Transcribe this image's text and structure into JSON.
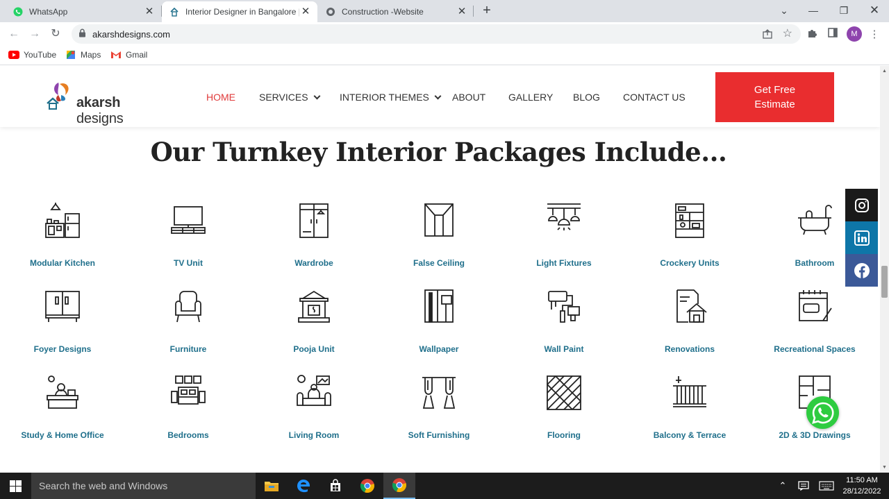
{
  "browser": {
    "tabs": [
      {
        "title": "WhatsApp",
        "icon": "whatsapp-icon",
        "active": false
      },
      {
        "title": "Interior Designer in Bangalore | Best",
        "icon": "akarsh-favicon",
        "active": true
      },
      {
        "title": "Construction -Website",
        "icon": "globe-icon",
        "active": false
      }
    ],
    "url": "akarshdesigns.com",
    "bookmarks": [
      {
        "label": "YouTube",
        "icon": "youtube-icon"
      },
      {
        "label": "Maps",
        "icon": "maps-icon"
      },
      {
        "label": "Gmail",
        "icon": "gmail-icon"
      }
    ],
    "profile_initial": "M"
  },
  "site": {
    "logo": {
      "brand_bold": "akarsh",
      "brand_rest": " designs"
    },
    "nav": [
      {
        "label": "HOME",
        "dropdown": false
      },
      {
        "label": "SERVICES",
        "dropdown": true
      },
      {
        "label": "INTERIOR THEMES",
        "dropdown": true
      },
      {
        "label": "ABOUT",
        "dropdown": false
      },
      {
        "label": "GALLERY",
        "dropdown": false
      },
      {
        "label": "BLOG",
        "dropdown": false
      },
      {
        "label": "CONTACT US",
        "dropdown": false
      }
    ],
    "cta_label": "Get Free Estimate",
    "section_title": "Our Turnkey Interior Packages Include...",
    "packages": [
      {
        "label": "Modular Kitchen",
        "icon": "kitchen-icon"
      },
      {
        "label": "TV Unit",
        "icon": "tv-unit-icon"
      },
      {
        "label": "Wardrobe",
        "icon": "wardrobe-icon"
      },
      {
        "label": "False Ceiling",
        "icon": "false-ceiling-icon"
      },
      {
        "label": "Light Fixtures",
        "icon": "light-fixtures-icon"
      },
      {
        "label": "Crockery Units",
        "icon": "crockery-icon"
      },
      {
        "label": "Bathroom",
        "icon": "bathtub-icon"
      },
      {
        "label": "Foyer Designs",
        "icon": "foyer-icon"
      },
      {
        "label": "Furniture",
        "icon": "armchair-icon"
      },
      {
        "label": "Pooja Unit",
        "icon": "temple-icon"
      },
      {
        "label": "Wallpaper",
        "icon": "wallpaper-icon"
      },
      {
        "label": "Wall Paint",
        "icon": "paint-roller-icon"
      },
      {
        "label": "Renovations",
        "icon": "renovation-icon"
      },
      {
        "label": "Recreational Spaces",
        "icon": "recreation-icon"
      },
      {
        "label": "Study & Home Office",
        "icon": "study-desk-icon"
      },
      {
        "label": "Bedrooms",
        "icon": "bed-icon"
      },
      {
        "label": "Living Room",
        "icon": "sofa-icon"
      },
      {
        "label": "Soft Furnishing",
        "icon": "curtains-icon"
      },
      {
        "label": "Flooring",
        "icon": "flooring-icon"
      },
      {
        "label": "Balcony & Terrace",
        "icon": "balcony-icon"
      },
      {
        "label": "2D & 3D Drawings",
        "icon": "floorplan-icon"
      }
    ],
    "social": [
      {
        "name": "instagram",
        "color": "#1a1a1a"
      },
      {
        "name": "linkedin",
        "color": "#0e76a8"
      },
      {
        "name": "facebook",
        "color": "#3b5998"
      }
    ]
  },
  "taskbar": {
    "search_placeholder": "Search the web and Windows",
    "time": "11:50 AM",
    "date": "28/12/2022"
  }
}
